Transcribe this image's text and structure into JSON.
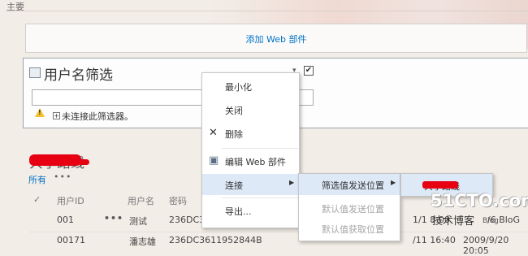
{
  "zone": {
    "label": "主要"
  },
  "add_web_part": {
    "label": "添加 Web 部件"
  },
  "filter": {
    "title": "用户名筛选",
    "chevron": "▾",
    "checked": "✔",
    "warning_text": "未连接此筛选器。",
    "expand": "+"
  },
  "list": {
    "title": "共享路线",
    "tab_all": "所有",
    "more": "•••",
    "columns": [
      "用户ID",
      "用户名",
      "密码"
    ],
    "check_mark": "✓",
    "rows": [
      {
        "id": "001",
        "name": "测试",
        "password": "236DC3…",
        "tail": "1/1 8:00",
        "tail2": "/6 BloG"
      },
      {
        "id": "00171",
        "name": "潘志雄",
        "password": "236DC3611952844B",
        "tail": "/11 16:40",
        "tail2": "2009/9/20 20:05"
      }
    ],
    "row_menu": "•••"
  },
  "context_menu": {
    "items": [
      {
        "label": "最小化",
        "icon": ""
      },
      {
        "label": "关闭",
        "icon": ""
      },
      {
        "label": "删除",
        "icon": "✕"
      },
      {
        "label": "编辑 Web 部件",
        "icon": "▣"
      },
      {
        "label": "连接",
        "icon": "",
        "arrow": "▶"
      },
      {
        "label": "导出...",
        "icon": ""
      }
    ]
  },
  "connect_submenu": {
    "items": [
      {
        "label": "筛选值发送位置",
        "arrow": "▶",
        "enabled": true
      },
      {
        "label": "默认值发送位置",
        "enabled": false
      },
      {
        "label": "默认值获取位置",
        "enabled": false
      }
    ]
  },
  "target_submenu": {
    "label": "共享路线"
  },
  "watermark": {
    "main": "51CTO.com",
    "sub": "技术博客",
    "blog": "Blog"
  },
  "colors": {
    "accent": "#0072c6",
    "menu_highlight": "#dde9f7",
    "redact": "#e60012"
  }
}
